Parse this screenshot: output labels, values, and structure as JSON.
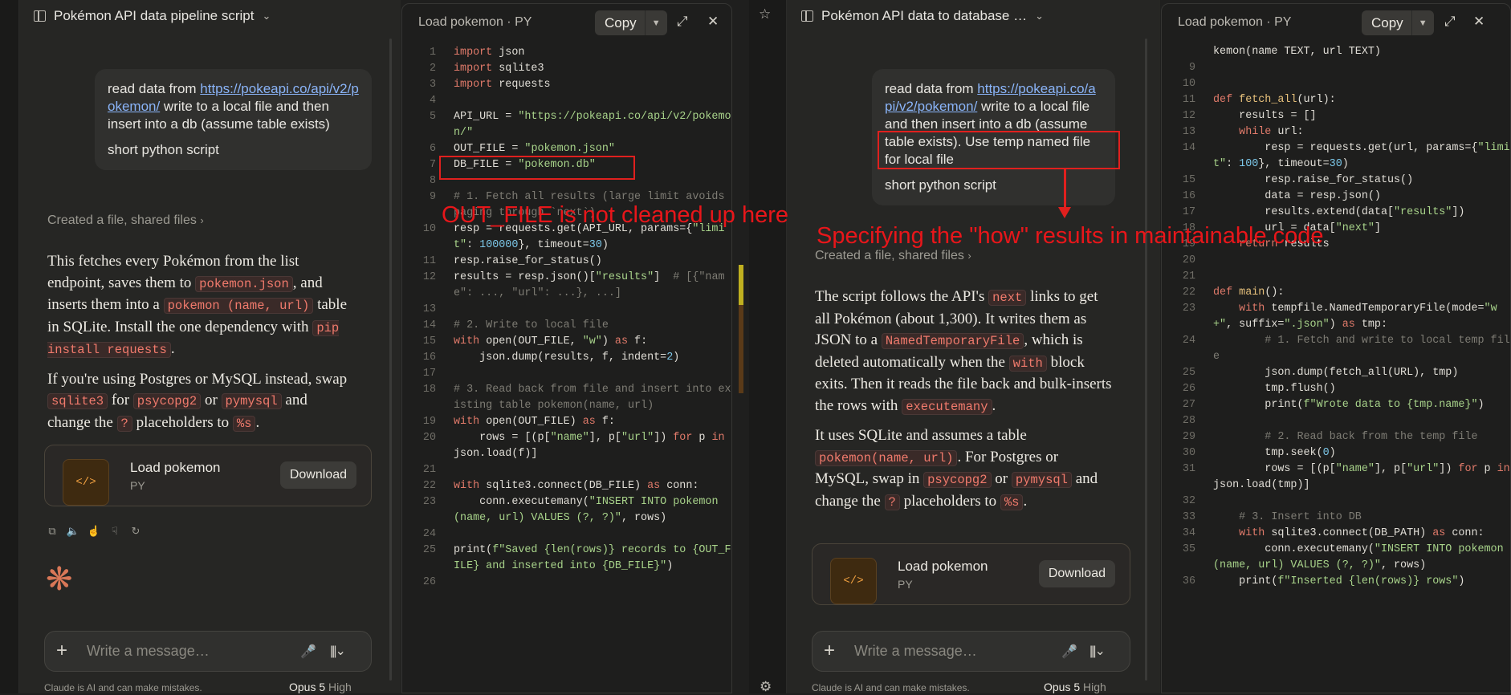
{
  "left": {
    "chat_title": "Pokémon API data pipeline script",
    "user_msg": {
      "prefix": "read data from ",
      "link": "https://pokeapi.co/api/v2/pokemon/",
      "suffix": " write to a local file and then insert into a db (assume table exists)",
      "second": "short python script"
    },
    "created": "Created a file, shared files",
    "response": {
      "p1_a": "This fetches every Pokémon from the list endpoint, saves them to ",
      "p1_code1": "pokemon.json",
      "p1_b": ", and inserts them into a ",
      "p1_code2": "pokemon (name, url)",
      "p1_c": " table in SQLite. Install the one dependency with ",
      "p1_code3": "pip install requests",
      "p1_d": ".",
      "p2_a": "If you're using Postgres or MySQL instead, swap ",
      "p2_code1": "sqlite3",
      "p2_b": " for ",
      "p2_code2": "psycopg2",
      "p2_c": " or ",
      "p2_code3": "pymysql",
      "p2_d": " and change the ",
      "p2_code4": "?",
      "p2_e": " placeholders to ",
      "p2_code5": "%s",
      "p2_f": "."
    },
    "file_card": {
      "name": "Load pokemon",
      "type": "PY",
      "download": "Download",
      "icon": "</>"
    },
    "composer_placeholder": "Write a message…",
    "footer_note": "Claude is AI and can make mistakes.",
    "model": "Opus 5",
    "effort": "High"
  },
  "left_code": {
    "title": "Load pokemon · PY",
    "copy": "Copy",
    "lines": [
      {
        "n": "1",
        "html": "<span class=\"kw\">import</span> json"
      },
      {
        "n": "2",
        "html": "<span class=\"kw\">import</span> sqlite3"
      },
      {
        "n": "3",
        "html": "<span class=\"kw\">import</span> requests"
      },
      {
        "n": "4",
        "html": ""
      },
      {
        "n": "5",
        "html": "API_URL = <span class=\"st\">\"https://pokeapi.co/api/v2/pokemon/\"</span>"
      },
      {
        "n": "6",
        "html": "OUT_FILE = <span class=\"st\">\"pokemon.json\"</span>"
      },
      {
        "n": "7",
        "html": "DB_FILE = <span class=\"st\">\"pokemon.db\"</span>"
      },
      {
        "n": "8",
        "html": ""
      },
      {
        "n": "9",
        "html": "<span class=\"cm\"># 1. Fetch all results (large limit avoids paging through `next`)</span>"
      },
      {
        "n": "10",
        "html": "resp = requests.get(API_URL, params={<span class=\"st\">\"limit\"</span>: <span class=\"nm\">100000</span>}, timeout=<span class=\"nm\">30</span>)"
      },
      {
        "n": "11",
        "html": "resp.raise_for_status()"
      },
      {
        "n": "12",
        "html": "results = resp.json()[<span class=\"st\">\"results\"</span>]  <span class=\"cm\"># [{\"name\": ..., \"url\": ...}, ...]</span>"
      },
      {
        "n": "13",
        "html": ""
      },
      {
        "n": "14",
        "html": "<span class=\"cm\"># 2. Write to local file</span>"
      },
      {
        "n": "15",
        "html": "<span class=\"kw\">with</span> open(OUT_FILE, <span class=\"st\">\"w\"</span>) <span class=\"kw\">as</span> f:"
      },
      {
        "n": "16",
        "html": "    json.dump(results, f, indent=<span class=\"nm\">2</span>)"
      },
      {
        "n": "17",
        "html": ""
      },
      {
        "n": "18",
        "html": "<span class=\"cm\"># 3. Read back from file and insert into existing table pokemon(name, url)</span>"
      },
      {
        "n": "19",
        "html": "<span class=\"kw\">with</span> open(OUT_FILE) <span class=\"kw\">as</span> f:"
      },
      {
        "n": "20",
        "html": "    rows = [(p[<span class=\"st\">\"name\"</span>], p[<span class=\"st\">\"url\"</span>]) <span class=\"kw\">for</span> p <span class=\"kw\">in</span> json.load(f)]"
      },
      {
        "n": "21",
        "html": ""
      },
      {
        "n": "22",
        "html": "<span class=\"kw\">with</span> sqlite3.connect(DB_FILE) <span class=\"kw\">as</span> conn:"
      },
      {
        "n": "23",
        "html": "    conn.executemany(<span class=\"st\">\"INSERT INTO pokemon (name, url) VALUES (?, ?)\"</span>, rows)"
      },
      {
        "n": "24",
        "html": ""
      },
      {
        "n": "25",
        "html": "print(<span class=\"st\">f\"Saved {len(rows)} records to {OUT_FILE} and inserted into {DB_FILE}\"</span>)"
      },
      {
        "n": "26",
        "html": ""
      }
    ]
  },
  "right": {
    "chat_title": "Pokémon API data to database …",
    "user_msg": {
      "prefix": "read data from ",
      "link": "https://pokeapi.co/api/v2/pokemon/",
      "suffix": " write to a local file and then insert into a db (assume table exists). Use temp named file for local file",
      "second": "short python script"
    },
    "created": "Created a file, shared files",
    "response": {
      "p1_a": "The script follows the API's ",
      "p1_code1": "next",
      "p1_b": " links to get all Pokémon (about 1,300). It writes them as JSON to a ",
      "p1_code2": "NamedTemporaryFile",
      "p1_c": ", which is deleted automatically when the ",
      "p1_code3": "with",
      "p1_d": " block exits. Then it reads the file back and bulk-inserts the rows with ",
      "p1_code4": "executemany",
      "p1_e": ".",
      "p2_a": "It uses SQLite and assumes a table ",
      "p2_code1": "pokemon(name, url)",
      "p2_b": ". For Postgres or MySQL, swap in ",
      "p2_code2": "psycopg2",
      "p2_c": " or ",
      "p2_code3": "pymysql",
      "p2_d": " and change the ",
      "p2_code4": "?",
      "p2_e": " placeholders to ",
      "p2_code5": "%s",
      "p2_f": "."
    },
    "file_card": {
      "name": "Load pokemon",
      "type": "PY",
      "download": "Download",
      "icon": "</>"
    },
    "composer_placeholder": "Write a message…",
    "footer_note": "Claude is AI and can make mistakes.",
    "model": "Opus 5",
    "effort": "High"
  },
  "right_code": {
    "title": "Load pokemon · PY",
    "copy": "Copy",
    "lines": [
      {
        "n": "",
        "html": "kemon(name TEXT, url TEXT)"
      },
      {
        "n": "9",
        "html": ""
      },
      {
        "n": "10",
        "html": ""
      },
      {
        "n": "11",
        "html": "<span class=\"kw\">def</span> <span class=\"fn\">fetch_all</span>(url):"
      },
      {
        "n": "12",
        "html": "    results = []"
      },
      {
        "n": "13",
        "html": "    <span class=\"kw\">while</span> url:"
      },
      {
        "n": "14",
        "html": "        resp = requests.get(url, params={<span class=\"st\">\"limit\"</span>: <span class=\"nm\">100</span>}, timeout=<span class=\"nm\">30</span>)"
      },
      {
        "n": "15",
        "html": "        resp.raise_for_status()"
      },
      {
        "n": "16",
        "html": "        data = resp.json()"
      },
      {
        "n": "17",
        "html": "        results.extend(data[<span class=\"st\">\"results\"</span>])"
      },
      {
        "n": "18",
        "html": "        url = data[<span class=\"st\">\"next\"</span>]"
      },
      {
        "n": "19",
        "html": "    <span class=\"kw\">return</span> results"
      },
      {
        "n": "20",
        "html": ""
      },
      {
        "n": "21",
        "html": ""
      },
      {
        "n": "22",
        "html": "<span class=\"kw\">def</span> <span class=\"fn\">main</span>():"
      },
      {
        "n": "23",
        "html": "    <span class=\"kw\">with</span> tempfile.NamedTemporaryFile(mode=<span class=\"st\">\"w+\"</span>, suffix=<span class=\"st\">\".json\"</span>) <span class=\"kw\">as</span> tmp:"
      },
      {
        "n": "24",
        "html": "        <span class=\"cm\"># 1. Fetch and write to local temp file</span>"
      },
      {
        "n": "25",
        "html": "        json.dump(fetch_all(URL), tmp)"
      },
      {
        "n": "26",
        "html": "        tmp.flush()"
      },
      {
        "n": "27",
        "html": "        print(<span class=\"st\">f\"Wrote data to {tmp.name}\"</span>)"
      },
      {
        "n": "28",
        "html": ""
      },
      {
        "n": "29",
        "html": "        <span class=\"cm\"># 2. Read back from the temp file</span>"
      },
      {
        "n": "30",
        "html": "        tmp.seek(<span class=\"nm\">0</span>)"
      },
      {
        "n": "31",
        "html": "        rows = [(p[<span class=\"st\">\"name\"</span>], p[<span class=\"st\">\"url\"</span>]) <span class=\"kw\">for</span> p <span class=\"kw\">in</span> json.load(tmp)]"
      },
      {
        "n": "32",
        "html": ""
      },
      {
        "n": "33",
        "html": "    <span class=\"cm\"># 3. Insert into DB</span>"
      },
      {
        "n": "34",
        "html": "    <span class=\"kw\">with</span> sqlite3.connect(DB_PATH) <span class=\"kw\">as</span> conn:"
      },
      {
        "n": "35",
        "html": "        conn.executemany(<span class=\"st\">\"INSERT INTO pokemon (name, url) VALUES (?, ?)\"</span>, rows)"
      },
      {
        "n": "36",
        "html": "    print(<span class=\"st\">f\"Inserted {len(rows)} rows\"</span>)"
      }
    ]
  },
  "annotations": {
    "left": "OUT_FILE is not cleaned up here",
    "right": "Specifying the \"how\" results in maintainable code"
  },
  "colors": {
    "annotation": "#e0201e",
    "accent": "#d97757",
    "link": "#8ab4f8"
  }
}
